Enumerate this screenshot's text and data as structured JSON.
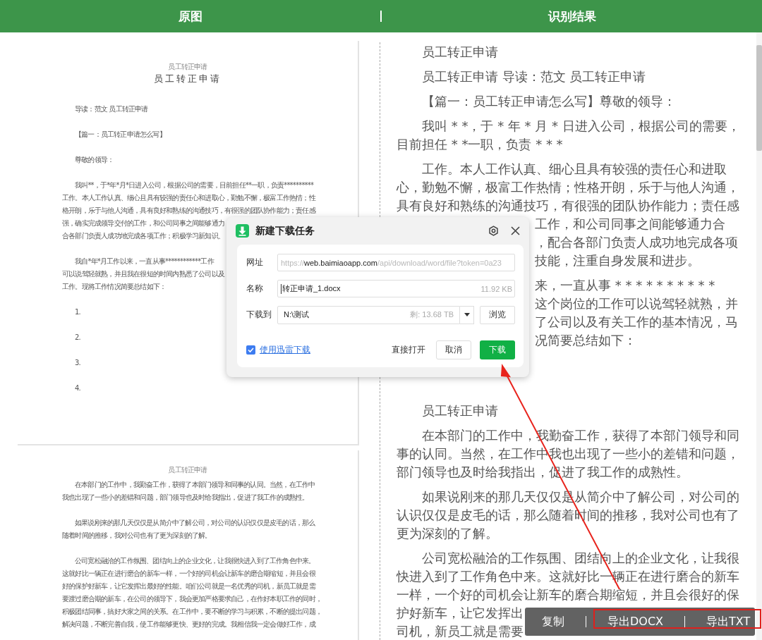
{
  "header": {
    "left_title": "原图",
    "right_title": "识别结果"
  },
  "original": {
    "pages": [
      {
        "blocks": [
          {
            "kind": "header",
            "lines": [
              "员工转正申请"
            ]
          },
          {
            "kind": "title",
            "lines": [
              "员工转正申请"
            ]
          },
          {
            "kind": "para",
            "lines": [
              "导读：范文 员工转正申请"
            ]
          },
          {
            "kind": "para",
            "lines": [
              "【篇一：员工转正申请怎么写】"
            ]
          },
          {
            "kind": "para",
            "lines": [
              "尊敬的领导："
            ]
          },
          {
            "kind": "para",
            "lines": [
              "我叫**，于*年*月*日进入公司，根据公司的需要，目前担任**一职，负责**********",
              "工作。本人工作认真、细心且具有较强的责任心和进取心，勤勉不懈，极富工作热情；性",
              "格开朗，乐于与他人沟通，具有良好和熟练的沟通技巧，有很强的团队协作能力；责任感",
              "强，确实完成领导交付的工作，和公司同事之间能够通力",
              "合各部门负责人成功地完成各项工作；积极学习新知识、"
            ]
          },
          {
            "kind": "para",
            "lines": [
              "我自*年*月工作以来，一直从事************工作",
              "可以说驾轻就熟，并且我在很短的时间内熟悉了公司以及",
              "工作。现将工作情况简要总结如下："
            ]
          },
          {
            "kind": "para",
            "lines": [
              "1."
            ]
          },
          {
            "kind": "para",
            "lines": [
              "2."
            ]
          },
          {
            "kind": "para",
            "lines": [
              "3."
            ]
          },
          {
            "kind": "para",
            "lines": [
              "4."
            ]
          }
        ]
      },
      {
        "blocks": [
          {
            "kind": "header",
            "lines": [
              "员工转正申请"
            ]
          },
          {
            "kind": "para",
            "lines": [
              "在本部门的工作中，我勤奋工作，获得了本部门领导和同事的认同。当然，在工作中",
              "我也出现了一些小的差错和问题，部门领导也及时给我指出，促进了我工作的成熟性。"
            ]
          },
          {
            "kind": "para",
            "lines": [
              "如果说刚来的那几天仅仅是从简介中了解公司，对公司的认识仅仅是皮毛的话，那么",
              "随着时间的推移，我对公司也有了更为深刻的了解。"
            ]
          },
          {
            "kind": "para",
            "lines": [
              "公司宽松融洽的工作氛围、团结向上的企业文化，让我很快进入到了工作角色中来。",
              "这就好比一辆正在进行磨合的新车一样，一个好的司机会让新车的磨合期缩短，并且会很",
              "好的保护好新车，让它发挥出最好的性能。咱们公司就是一名优秀的司机，新员工就是需",
              "要渡过磨合期的新车，在公司的领导下，我会更加严格要求自己，在作好本职工作的同时，",
              "积极团结同事，搞好大家之间的关系。在工作中，要不断的学习与积累，不断的提出问题，",
              "解决问题，不断完善自我，使工作能够更快、更好的完成。我相信我一定会做好工作，成"
            ]
          }
        ]
      }
    ]
  },
  "result": {
    "sections": [
      {
        "paragraphs": [
          {
            "lines": [
              {
                "kind": "indent",
                "text": "员工转正申请"
              }
            ]
          },
          {
            "lines": [
              {
                "kind": "indent",
                "text": "员工转正申请 导读：范文 员工转正申请"
              }
            ]
          },
          {
            "lines": [
              {
                "kind": "indent",
                "text": "【篇一：员工转正申请怎么写】尊敬的领导："
              }
            ]
          },
          {
            "lines": [
              {
                "kind": "indent",
                "text": "我叫 * *，于 * 年 * 月 * 日进入公司，根据公司的需要，"
              },
              {
                "kind": "wrap",
                "text": "目前担任 * *一职，负责 * * *"
              }
            ]
          },
          {
            "lines": [
              {
                "kind": "indent",
                "text": "工作。本人工作认真、细心且具有较强的责任心和进取"
              },
              {
                "kind": "wrap",
                "text": "心，勤勉不懈，极富工作热情；性格开朗，乐于与他人沟通，"
              },
              {
                "kind": "wrap",
                "text": "具有良好和熟练的沟通技巧，有很强的团队协作能力；责任感"
              },
              {
                "kind": "tail",
                "text": "工作，和公司同事之间能够通力合"
              },
              {
                "kind": "tail",
                "text": "，配合各部门负责人成功地完成各项"
              },
              {
                "kind": "tail",
                "text": "技能，注重自身发展和进步。"
              }
            ]
          },
          {
            "lines": [
              {
                "kind": "tail",
                "text": "来，一直从事 * * * * * * * * * *"
              },
              {
                "kind": "tail",
                "text": "这个岗位的工作可以说驾轻就熟，并"
              },
              {
                "kind": "tail",
                "text": "了公司以及有关工作的基本情况，马"
              },
              {
                "kind": "tail",
                "text": "况简要总结如下："
              }
            ]
          }
        ]
      },
      {
        "paragraphs": [
          {
            "lines": [
              {
                "kind": "indent",
                "text": "员工转正申请"
              }
            ]
          },
          {
            "lines": [
              {
                "kind": "indent",
                "text": "在本部门的工作中，我勤奋工作，获得了本部门领导和同"
              },
              {
                "kind": "wrap",
                "text": "事的认同。当然，在工作中我也出现了一些小的差错和问题，"
              },
              {
                "kind": "wrap",
                "text": "部门领导也及时给我指出，促进了我工作的成熟性。"
              }
            ]
          },
          {
            "lines": [
              {
                "kind": "indent",
                "text": "如果说刚来的那几天仅仅是从简介中了解公司，对公司的"
              },
              {
                "kind": "wrap",
                "text": "认识仅仅是皮毛的话，那么随着时间的推移，我对公司也有了"
              },
              {
                "kind": "wrap",
                "text": "更为深刻的了解。"
              }
            ]
          },
          {
            "lines": [
              {
                "kind": "indent",
                "text": "公司宽松融洽的工作氛围、团结向上的企业文化，让我很"
              },
              {
                "kind": "wrap",
                "text": "快进入到了工作角色中来。这就好比一辆正在进行磨合的新车"
              },
              {
                "kind": "wrap",
                "text": "一样，一个好的司机会让新车的磨合期缩短，并且会很好的保"
              },
              {
                "kind": "wrap",
                "text": "护好新车，让它发挥出"
              },
              {
                "kind": "wrap",
                "text": "司机，新员工就是需要"
              }
            ]
          }
        ]
      }
    ]
  },
  "dialog": {
    "title": "新建下载任务",
    "fields": [
      {
        "kind": "url",
        "label": "网址",
        "parts": [
          {
            "kind": "dim",
            "text": "https://"
          },
          {
            "kind": "host",
            "text": "web.baimiaoapp.com"
          },
          {
            "kind": "dim",
            "text": "/api/download/word/file?token=0a23"
          }
        ]
      },
      {
        "kind": "name",
        "label": "名称",
        "value": "转正申请_1.docx",
        "size": "11.92 KB"
      },
      {
        "kind": "folder",
        "label": "下载到",
        "value": "N:\\测试",
        "free": "剩: 13.68 TB",
        "button": "浏览"
      }
    ],
    "use_thunder": {
      "label": "使用迅雷下载",
      "checked": true
    },
    "buttons": [
      {
        "kind": "text",
        "label": "直接打开"
      },
      {
        "kind": "outline",
        "label": "取消"
      },
      {
        "kind": "primary",
        "label": "下载"
      }
    ]
  },
  "toolbar": {
    "buttons": [
      {
        "label": "复制",
        "highlighted": false
      },
      {
        "label": "导出DOCX",
        "highlighted": true
      },
      {
        "label": "导出TXT",
        "highlighted": true
      }
    ]
  }
}
